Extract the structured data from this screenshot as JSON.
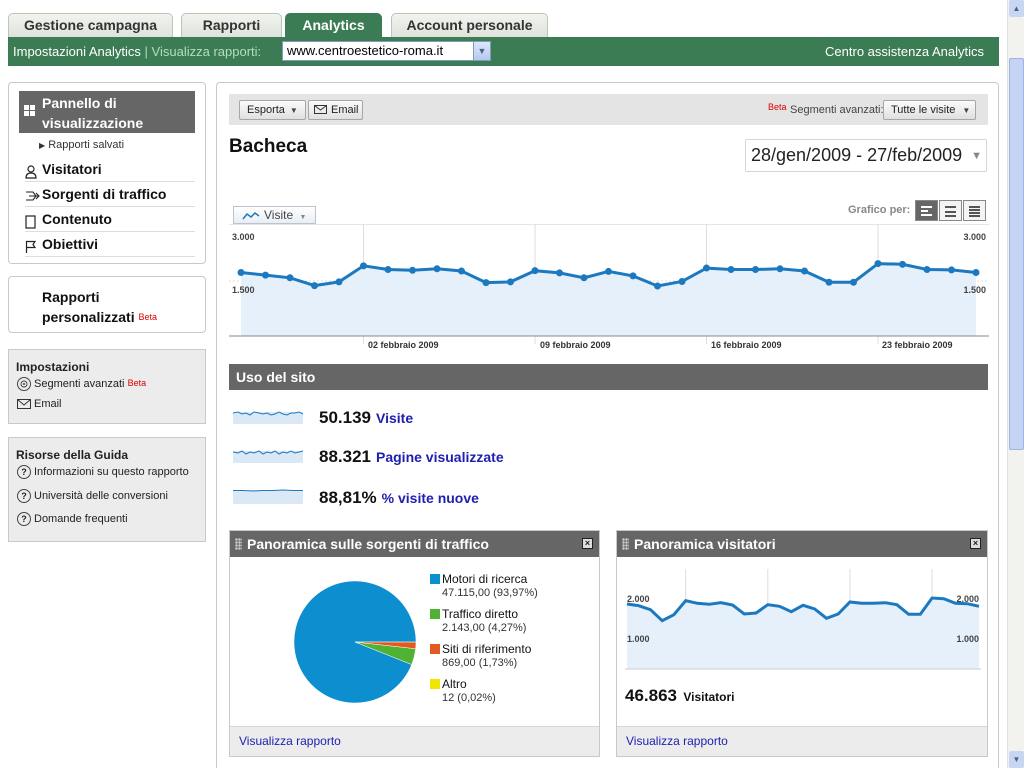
{
  "tabs": [
    {
      "label": "Gestione campagna",
      "active": false
    },
    {
      "label": "Rapporti",
      "active": false
    },
    {
      "label": "Analytics",
      "active": true
    },
    {
      "label": "Account personale",
      "active": false
    }
  ],
  "greenbar": {
    "settings_link": "Impostazioni Analytics",
    "separator": "|",
    "view_reports_label": "Visualizza rapporti:",
    "site_select": "www.centroestetico-roma.it",
    "help_link": "Centro assistenza Analytics"
  },
  "sidebar": {
    "dashboard": {
      "label_line1": "Pannello di",
      "label_line2": "visualizzazione"
    },
    "saved_reports": "Rapporti salvati",
    "nav": [
      {
        "label": "Visitatori",
        "icon": "person-icon"
      },
      {
        "label": "Sorgenti di traffico",
        "icon": "traffic-sources-icon"
      },
      {
        "label": "Contenuto",
        "icon": "content-icon"
      },
      {
        "label": "Obiettivi",
        "icon": "flag-icon"
      }
    ],
    "custom_reports": {
      "line1": "Rapporti",
      "line2": "personalizzati",
      "badge": "Beta"
    },
    "settings": {
      "title": "Impostazioni",
      "items": [
        {
          "label": "Segmenti avanzati",
          "badge": "Beta",
          "icon": "target-icon"
        },
        {
          "label": "Email",
          "icon": "envelope-icon"
        }
      ]
    },
    "help": {
      "title": "Risorse della Guida",
      "items": [
        {
          "label": "Informazioni su questo rapporto",
          "icon": "help-icon"
        },
        {
          "label": "Università delle conversioni",
          "icon": "help-icon"
        },
        {
          "label": "Domande frequenti",
          "icon": "help-icon"
        }
      ]
    }
  },
  "toolbar": {
    "export_label": "Esporta",
    "email_label": "Email",
    "beta_badge": "Beta",
    "segments_label": "Segmenti avanzati:",
    "segments_value": "Tutte le visite"
  },
  "dashboard": {
    "title": "Bacheca",
    "date_range": "28/gen/2009 - 27/feb/2009",
    "metric_selector": "Visite",
    "graph_by_label": "Grafico per:"
  },
  "chart_data": [
    {
      "type": "line",
      "id": "visits-over-time",
      "series": [
        {
          "name": "Visite",
          "values": [
            1700,
            1630,
            1560,
            1350,
            1450,
            1880,
            1780,
            1760,
            1800,
            1740,
            1430,
            1450,
            1750,
            1690,
            1560,
            1730,
            1610,
            1340,
            1460,
            1820,
            1780,
            1780,
            1800,
            1740,
            1440,
            1440,
            1940,
            1920,
            1780,
            1770,
            1700
          ]
        }
      ],
      "x_tick_labels": [
        "02 febbraio 2009",
        "09 febbraio 2009",
        "16 febbraio 2009",
        "23 febbraio 2009"
      ],
      "y_tick_labels_left": [
        "3.000",
        "1.500"
      ],
      "y_tick_labels_right": [
        "3.000",
        "1.500"
      ],
      "ylim": [
        0,
        3000
      ],
      "color": "#1c79c0"
    },
    {
      "type": "pie",
      "id": "traffic-sources",
      "slices": [
        {
          "label": "Motori di ricerca",
          "value": 47115,
          "display": "47.115,00 (93,97%)",
          "color": "#0d8ecf"
        },
        {
          "label": "Traffico diretto",
          "value": 2143,
          "display": "2.143,00 (4,27%)",
          "color": "#4fb233"
        },
        {
          "label": "Siti di riferimento",
          "value": 869,
          "display": "869,00 (1,73%)",
          "color": "#e25a22"
        },
        {
          "label": "Altro",
          "value": 12,
          "display": "12 (0,02%)",
          "color": "#f2e500"
        }
      ]
    },
    {
      "type": "line",
      "id": "visitors-over-time",
      "series": [
        {
          "name": "Visitatori",
          "values": [
            1950,
            1900,
            1780,
            1450,
            1630,
            2050,
            1970,
            1940,
            1990,
            1920,
            1650,
            1680,
            1930,
            1880,
            1720,
            1910,
            1800,
            1520,
            1650,
            2010,
            1970,
            1970,
            1990,
            1930,
            1640,
            1640,
            2130,
            2110,
            1970,
            1960,
            1880
          ]
        }
      ],
      "y_tick_labels_left": [
        "2.000",
        "1.000"
      ],
      "y_tick_labels_right": [
        "2.000",
        "1.000"
      ],
      "ylim": [
        0,
        3000
      ],
      "color": "#1c79c0"
    }
  ],
  "site_usage": {
    "title": "Uso del sito",
    "rows": [
      {
        "value": "50.139",
        "label": "Visite"
      },
      {
        "value": "88.321",
        "label": "Pagine visualizzate"
      },
      {
        "value": "88,81%",
        "label": "% visite nuove"
      }
    ]
  },
  "traffic_panel": {
    "title": "Panoramica sulle sorgenti di traffico",
    "footer_link": "Visualizza rapporto"
  },
  "visitors_panel": {
    "title": "Panoramica visitatori",
    "total": "46.863",
    "total_label": "Visitatori",
    "footer_link": "Visualizza rapporto"
  }
}
